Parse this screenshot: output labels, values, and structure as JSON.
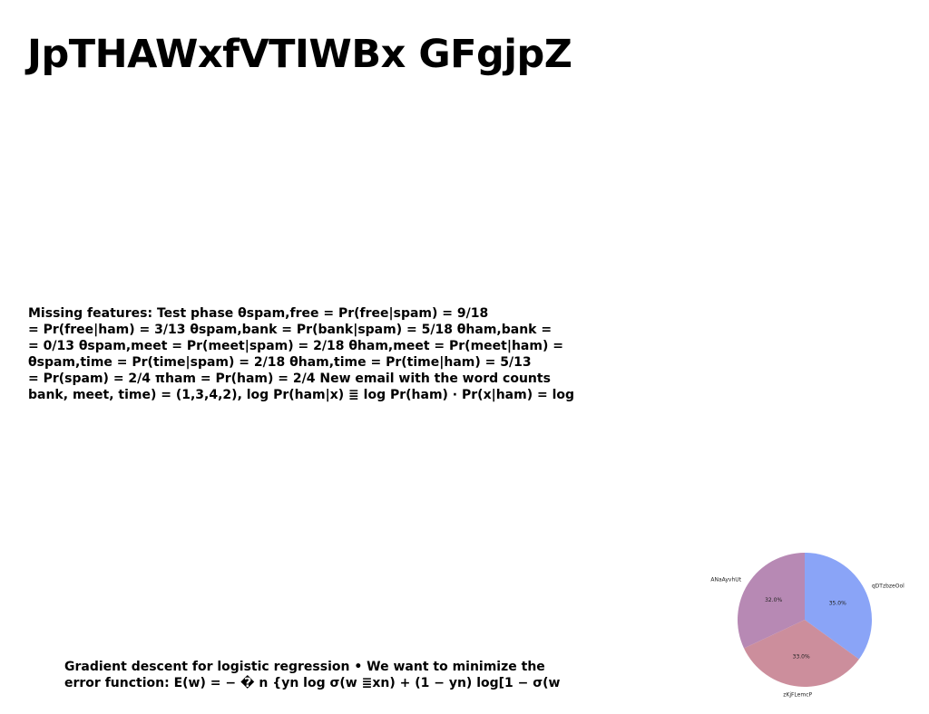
{
  "title": "JpTHAWxfVTIWBx GFgjpZ",
  "paragraph1": {
    "lines": [
      "Missing features: Test phase θspam,free = Pr(free|spam) = 9/18",
      "= Pr(free|ham) = 3/13 θspam,bank = Pr(bank|spam) = 5/18 θham,bank =",
      "= 0/13 θspam,meet = Pr(meet|spam) = 2/18 θham,meet = Pr(meet|ham) =",
      "θspam,time = Pr(time|spam) = 2/18 θham,time = Pr(time|ham) = 5/13",
      "= Pr(spam) = 2/4 πham = Pr(ham) = 2/4 New email with the word counts",
      "bank, meet, time) = (1,3,4,2), log Pr(ham|x) ≣ log Pr(ham) · Pr(x|ham) = log"
    ]
  },
  "paragraph2": {
    "lines": [
      "Gradient descent for logistic regression • We want to minimize the",
      "error function: E(w) = − � n {yn log σ(w ≣xn) + (1 − yn) log[1 − σ(w"
    ]
  },
  "chart_data": {
    "type": "pie",
    "slices": [
      {
        "label": "qDTzbzeOol",
        "value": 35.0,
        "pct_label": "35.0%",
        "color": "#8aa4f7"
      },
      {
        "label": "zKjFLemcP",
        "value": 33.0,
        "pct_label": "33.0%",
        "color": "#cc8e9c"
      },
      {
        "label": "ANaAyvhUt",
        "value": 32.0,
        "pct_label": "32.0%",
        "color": "#b789b4"
      }
    ],
    "start_angle": "12 o'clock",
    "direction": "clockwise"
  }
}
